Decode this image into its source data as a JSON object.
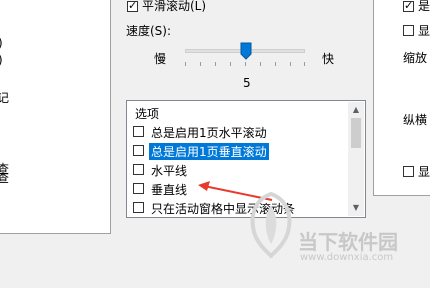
{
  "left_panel": {
    "frag1": ")",
    "frag2": ")",
    "frag3": "记",
    "frag4": "查",
    "frag5": "查"
  },
  "smooth_scroll": {
    "label": "平滑滚动(L)",
    "checked": true
  },
  "speed": {
    "label": "速度(S):",
    "slow": "慢",
    "fast": "快",
    "value": "5"
  },
  "options": {
    "header": "选项",
    "items": [
      {
        "label": "总是启用1页水平滚动",
        "checked": false,
        "selected": false
      },
      {
        "label": "总是启用1页垂直滚动",
        "checked": false,
        "selected": true
      },
      {
        "label": "水平线",
        "checked": false,
        "selected": false
      },
      {
        "label": "垂直线",
        "checked": false,
        "selected": false
      },
      {
        "label": "只在活动窗格中显示滚动条",
        "checked": false,
        "selected": false
      }
    ]
  },
  "right_panel": {
    "item1": "是",
    "item2": "显",
    "label1": "缩放",
    "label2": "纵横",
    "item3": "显"
  },
  "watermark": {
    "title": "当下软件园",
    "url": "www.downxia.com"
  },
  "colors": {
    "selection": "#0078d7",
    "arrow": "#e8392d",
    "slider": "#0078d7"
  }
}
